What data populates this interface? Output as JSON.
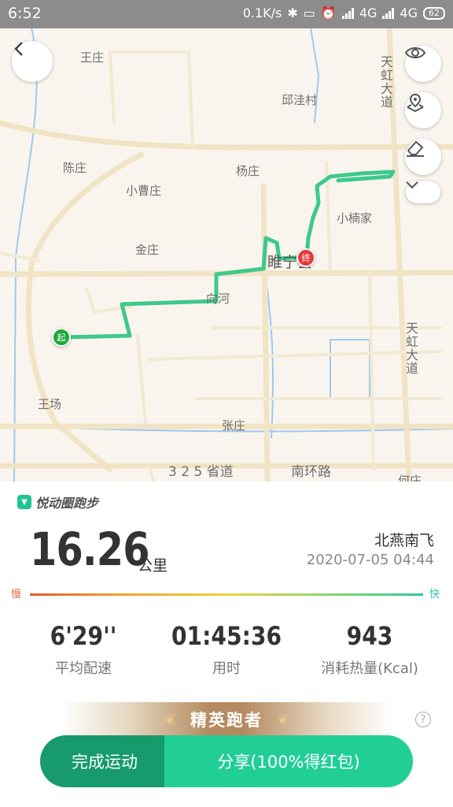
{
  "status_bar": {
    "time": "6:52",
    "speed": "0.1K/s",
    "network1": "4G",
    "network2": "4G",
    "battery": "62"
  },
  "map": {
    "labels": [
      "王庄",
      "邱洼村",
      "陈庄",
      "杨庄",
      "小曹庄",
      "小楠家",
      "金庄",
      "睢宁县",
      "向河",
      "王场",
      "张庄",
      "3 2 5 省道",
      "南环路",
      "何庄"
    ],
    "road_labels": [
      "天虹大道",
      "天虹大道"
    ],
    "start_marker": "起",
    "end_marker": "终",
    "route_color": "#3ec98c",
    "buttons": [
      "back-icon",
      "eye-icon",
      "map-pin-icon",
      "eraser-icon",
      "chevron-down-icon"
    ]
  },
  "card": {
    "brand": "悦动圈跑步",
    "distance": "16.26",
    "unit": "公里",
    "username": "北燕南飞",
    "datetime": "2020-07-05 04:44",
    "slow_label": "慢",
    "fast_label": "快",
    "stats": [
      {
        "value": "6'29''",
        "label": "平均配速"
      },
      {
        "value": "01:45:36",
        "label": "用时"
      },
      {
        "value": "943",
        "label": "消耗热量(Kcal)"
      }
    ],
    "badge": "精英跑者",
    "help": "?",
    "finish_button": "完成运动",
    "share_button": "分享(100%得红包)"
  },
  "colors": {
    "accent": "#21cf96",
    "accent_dark": "#179a6c"
  }
}
